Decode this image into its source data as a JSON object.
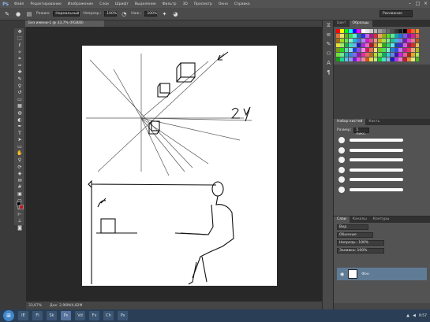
{
  "app": {
    "logo_text": "Ps",
    "menu": [
      "Файл",
      "Редактирование",
      "Изображение",
      "Слои",
      "Шрифт",
      "Выделение",
      "Фильтр",
      "3D",
      "Просмотр",
      "Окно",
      "Справка"
    ]
  },
  "options_bar": {
    "mode_label": "Режим:",
    "mode_value": "Нормальный",
    "opacity_label": "Непрозр.:",
    "opacity_value": "100%",
    "flow_label": "Наж.:",
    "flow_value": "100%",
    "workspace": "Рисование"
  },
  "document": {
    "tab_title": "Без имени-1 @ 33,7% (RGB/8)"
  },
  "tools": [
    "move",
    "marquee",
    "lasso",
    "quick-select",
    "crop",
    "eyedropper",
    "healing",
    "brush",
    "clone-stamp",
    "history-brush",
    "eraser",
    "gradient",
    "blur",
    "dodge",
    "pen",
    "type",
    "path-select",
    "shape",
    "hand",
    "zoom",
    "rotate",
    "3d",
    "note",
    "count",
    "frame",
    "artboard",
    "slice",
    "ruler",
    "measure",
    "mask"
  ],
  "colors": {
    "foreground": "#000000",
    "background": "#c0161b"
  },
  "status": {
    "zoom": "33,67%",
    "doc_info": "Док: 2,96M/4,82M"
  },
  "panels": {
    "swatches_tabs": [
      "Цвет",
      "Образцы"
    ],
    "brush_tabs": [
      "Набор кистей",
      "Кисть"
    ],
    "brush_size_label": "Размер:",
    "brush_size_value": "5 пикс.",
    "layers_tabs": [
      "Слои",
      "Каналы",
      "Контуры"
    ],
    "layer_kind": "Вид",
    "layer_blend": "Обычные",
    "layer_opacity": "Непрозр.: 100%",
    "layer_fill": "Заливка: 100%",
    "layers": [
      {
        "name": "Фон"
      }
    ]
  },
  "taskbar": {
    "start_label": "⊞",
    "apps": [
      "IE",
      "Fl",
      "Sk",
      "Ps",
      "Vd",
      "Fx",
      "Ch",
      "Ps"
    ],
    "clock": "9:57"
  }
}
